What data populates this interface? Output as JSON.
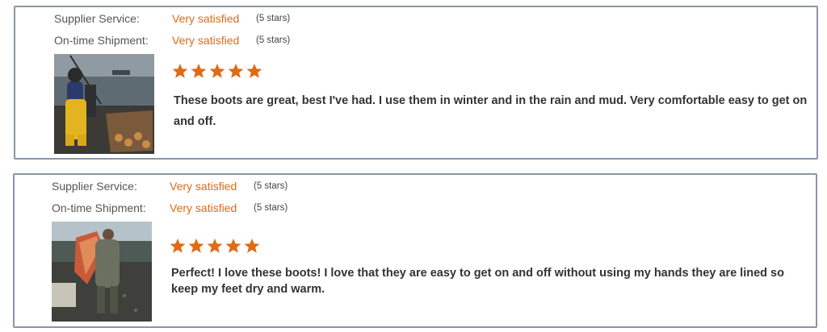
{
  "reviews": [
    {
      "supplier_label": "Supplier Service:",
      "supplier_value": "Very satisfied",
      "supplier_note": "(5 stars)",
      "shipment_label": "On-time Shipment:",
      "shipment_value": "Very satisfied",
      "shipment_note": "(5 stars)",
      "rating": 5,
      "text": "These boots are great, best I've had. I use them in winter and in the rain and mud. Very comfortable easy to get on and off."
    },
    {
      "supplier_label": "Supplier Service:",
      "supplier_value": "Very satisfied",
      "supplier_note": "(5 stars)",
      "shipment_label": "On-time Shipment:",
      "shipment_value": "Very satisfied",
      "shipment_note": "(5 stars)",
      "rating": 5,
      "text": "Perfect! I love these boots! I love that they are easy to get on and off without using my hands they are lined so keep my feet dry and warm."
    }
  ],
  "colors": {
    "accent": "#e06a18",
    "border": "#8a96a6"
  },
  "icons": {
    "rating": "star-icon"
  }
}
